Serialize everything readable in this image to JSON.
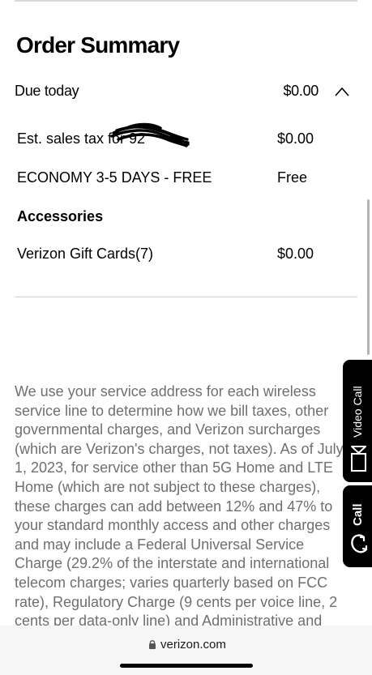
{
  "summary": {
    "title": "Order Summary",
    "due_label": "Due today",
    "due_amount": "$0.00",
    "items": [
      {
        "label": "Est. sales tax for 92",
        "value": "$0.00"
      },
      {
        "label": "ECONOMY 3-5 DAYS - FREE",
        "value": "Free"
      }
    ],
    "accessories_heading": "Accessories",
    "accessories": [
      {
        "label": "Verizon Gift Cards(7)",
        "value": "$0.00"
      }
    ]
  },
  "disclaimer": {
    "lines": [
      "We use your service address for each wireless",
      "service line to determine how we bill taxes, other",
      "governmental charges, and Verizon surcharges",
      "(which are Verizon's charges, not taxes). As of July",
      "1, 2023, for service other than 5G Home and LTE",
      "Home (which are not subject to these charges),",
      "these charges can add between 12% and 47% to",
      "your standard monthly access and other charges",
      "and may include a Federal Universal Service",
      "Charge (29.2% of the interstate and international",
      "telecom charges; varies quarterly based on FCC",
      "rate), Regulatory Charge (9 cents per voice line, 2",
      "cents per data-only line) and Administrative and"
    ]
  },
  "side_tabs": {
    "video_call": "Video Call",
    "call": "Call"
  },
  "browser": {
    "url": "verizon.com"
  },
  "icons": {
    "chevron": "chevron-up-icon",
    "lock": "lock-icon",
    "video": "video-camera-icon",
    "call": "phone-icon"
  }
}
